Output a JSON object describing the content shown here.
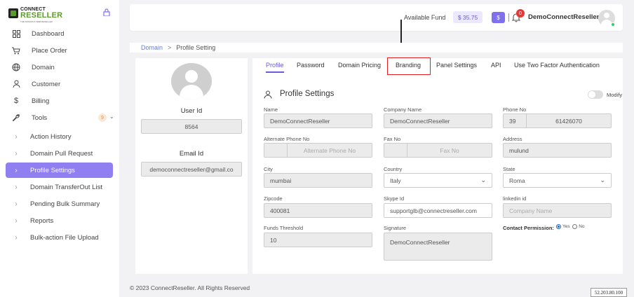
{
  "brand": {
    "line1": "CONNECT",
    "line2": "RESELLER",
    "tagline": "THE DOMAIN & WEB RESELLER"
  },
  "sidebar": {
    "items": [
      {
        "label": "Dashboard",
        "icon": "grid-icon"
      },
      {
        "label": "Place Order",
        "icon": "cart-icon"
      },
      {
        "label": "Domain",
        "icon": "globe-icon"
      },
      {
        "label": "Customer",
        "icon": "user-icon"
      },
      {
        "label": "Billing",
        "icon": "dollar-icon"
      },
      {
        "label": "Tools",
        "icon": "wrench-icon",
        "badge": "9"
      },
      {
        "label": "Action History",
        "icon": "chevron-right-icon"
      },
      {
        "label": "Domain Pull Request",
        "icon": "chevron-right-icon"
      },
      {
        "label": "Profile Settings",
        "icon": "chevron-right-icon",
        "active": true
      },
      {
        "label": "Domain TransferOut List",
        "icon": "chevron-right-icon"
      },
      {
        "label": "Pending Bulk Summary",
        "icon": "chevron-right-icon"
      },
      {
        "label": "Reports",
        "icon": "chevron-right-icon"
      },
      {
        "label": "Bulk-action File Upload",
        "icon": "chevron-right-icon"
      }
    ]
  },
  "header": {
    "available_fund_label": "Available Fund",
    "fund_amount": "$ 35.75",
    "dollar_button": "$",
    "notification_count": "0",
    "username": "DemoConnectReseller"
  },
  "breadcrumb": {
    "parent": "Domain",
    "separator": ">",
    "current": "Profile Setting"
  },
  "profile_card": {
    "user_id_label": "User Id",
    "user_id": "8564",
    "email_label": "Email Id",
    "email": "democonnectreseller@gmail.co"
  },
  "tabs": [
    "Profile",
    "Password",
    "Domain Pricing",
    "Branding",
    "Panel Settings",
    "API",
    "Use Two Factor Authentication"
  ],
  "form": {
    "title": "Profile Settings",
    "modify_label": "Modify",
    "name": {
      "label": "Name",
      "value": "DemoConnectReseller"
    },
    "company_name": {
      "label": "Company Name",
      "value": "DemoConnectReseller"
    },
    "phone_no": {
      "label": "Phone No",
      "code": "39",
      "value": "61426070"
    },
    "alt_phone": {
      "label": "Alternate Phone No",
      "placeholder": "Alternate Phone No"
    },
    "fax_no": {
      "label": "Fax No",
      "placeholder": "Fax No"
    },
    "address": {
      "label": "Address",
      "value": "mulund"
    },
    "city": {
      "label": "City",
      "value": "mumbai"
    },
    "country": {
      "label": "Country",
      "value": "Italy"
    },
    "state": {
      "label": "State",
      "value": "Roma"
    },
    "zipcode": {
      "label": "Zipcode",
      "value": "400081"
    },
    "skype_id": {
      "label": "Skype Id",
      "value": "supportglb@connectreseller.com"
    },
    "linkedin_id": {
      "label": "linkedin id",
      "placeholder": "Company Name"
    },
    "funds_threshold": {
      "label": "Funds Threshold",
      "value": "10"
    },
    "signature": {
      "label": "Signature",
      "value": "DemoConnectReseller"
    },
    "contact_permission": {
      "label": "Contact Permission:",
      "yes": "Yes",
      "no": "No",
      "selected": "Yes"
    }
  },
  "footer": {
    "copyright": "© 2023 ConnectReseller. All Rights Reserved"
  },
  "ip_overlay": "52.203.80.100",
  "colors": {
    "accent": "#7f70ee",
    "active_nav": "#8f7ff0",
    "brand_green": "#5b9b2b",
    "highlight": "#e02020"
  }
}
